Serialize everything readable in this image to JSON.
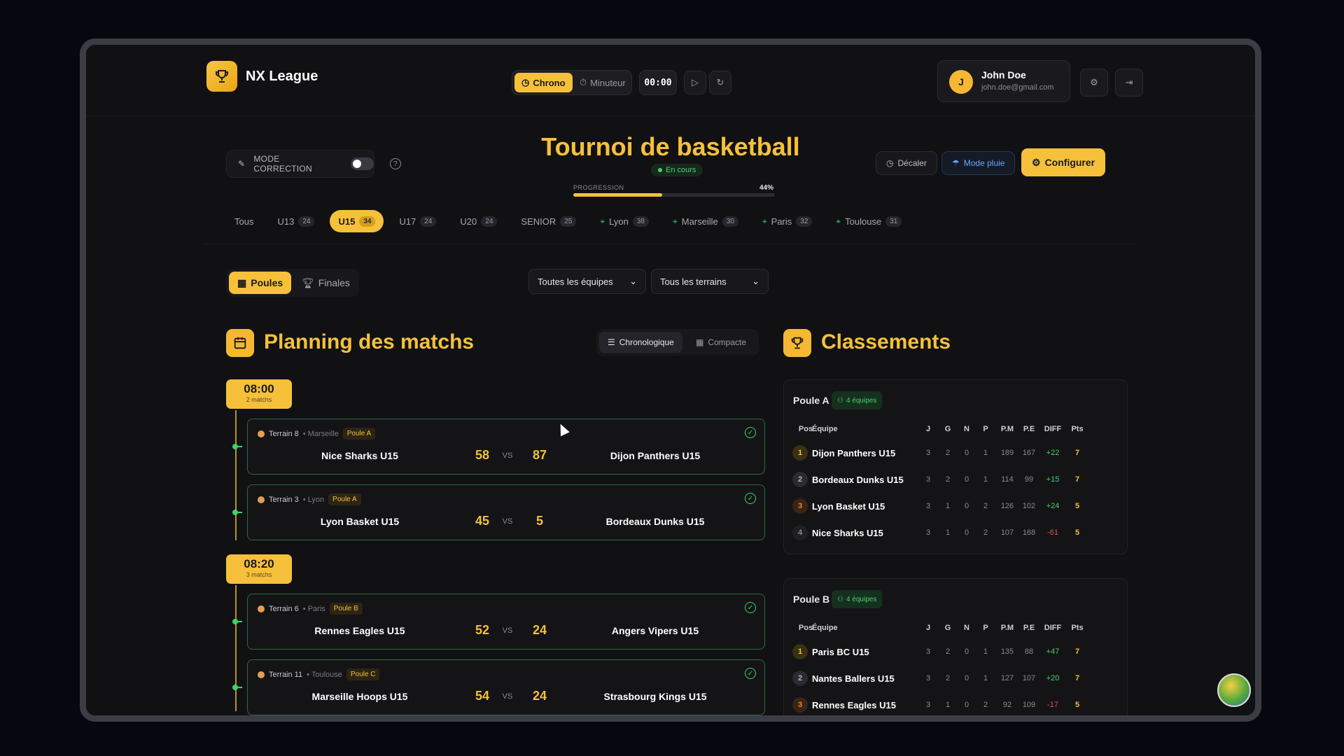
{
  "app": {
    "name": "NX League"
  },
  "timer": {
    "chrono_label": "Chrono",
    "minuteur_label": "Minuteur",
    "time": "00:00"
  },
  "user": {
    "initial": "J",
    "name": "John Doe",
    "email": "john.doe@gmail.com"
  },
  "toolbar": {
    "mode_correction": "MODE CORRECTION",
    "decaler": "Décaler",
    "mode_pluie": "Mode pluie",
    "configurer": "Configurer"
  },
  "tournament": {
    "title": "Tournoi de basketball",
    "status": "En cours",
    "progress_label": "PROGRESSION",
    "progress_text": "44%",
    "progress_value": 0.44
  },
  "categories": [
    {
      "label": "Tous",
      "count": "",
      "active": false,
      "location": false
    },
    {
      "label": "U13",
      "count": "24",
      "active": false,
      "location": false
    },
    {
      "label": "U15",
      "count": "34",
      "active": true,
      "location": false
    },
    {
      "label": "U17",
      "count": "24",
      "active": false,
      "location": false
    },
    {
      "label": "U20",
      "count": "24",
      "active": false,
      "location": false
    },
    {
      "label": "SENIOR",
      "count": "25",
      "active": false,
      "location": false
    },
    {
      "label": "Lyon",
      "count": "38",
      "active": false,
      "location": true
    },
    {
      "label": "Marseille",
      "count": "30",
      "active": false,
      "location": true
    },
    {
      "label": "Paris",
      "count": "32",
      "active": false,
      "location": true
    },
    {
      "label": "Toulouse",
      "count": "31",
      "active": false,
      "location": true
    }
  ],
  "phases": {
    "poules": "Poules",
    "finales": "Finales"
  },
  "filters": {
    "teams": "Toutes les équipes",
    "terrains": "Tous les terrains"
  },
  "planning": {
    "title": "Planning des matchs",
    "view_chrono": "Chronologique",
    "view_compact": "Compacte",
    "vs_label": "VS"
  },
  "slots": [
    {
      "time": "08:00",
      "count_label": "2 matchs",
      "matches": [
        {
          "terrain": "Terrain 8",
          "city": "• Marseille",
          "poule": "Poule A",
          "home": "Nice Sharks U15",
          "home_score": "58",
          "away_score": "87",
          "away": "Dijon Panthers U15"
        },
        {
          "terrain": "Terrain 3",
          "city": "• Lyon",
          "poule": "Poule A",
          "home": "Lyon Basket U15",
          "home_score": "45",
          "away_score": "5",
          "away": "Bordeaux Dunks U15"
        }
      ]
    },
    {
      "time": "08:20",
      "count_label": "3 matchs",
      "matches": [
        {
          "terrain": "Terrain 6",
          "city": "• Paris",
          "poule": "Poule B",
          "home": "Rennes Eagles U15",
          "home_score": "52",
          "away_score": "24",
          "away": "Angers Vipers U15"
        },
        {
          "terrain": "Terrain 11",
          "city": "• Toulouse",
          "poule": "Poule C",
          "home": "Marseille Hoops U15",
          "home_score": "54",
          "away_score": "24",
          "away": "Strasbourg Kings U15"
        }
      ]
    }
  ],
  "standings": {
    "title": "Classements",
    "headers": [
      "Pos",
      "Équipe",
      "J",
      "G",
      "N",
      "P",
      "P.M",
      "P.E",
      "DIFF",
      "Pts"
    ],
    "pools": [
      {
        "name": "Poule A",
        "badge": "4 équipes",
        "rows": [
          [
            "1",
            "Dijon Panthers U15",
            "3",
            "2",
            "0",
            "1",
            "189",
            "167",
            "+22",
            "7"
          ],
          [
            "2",
            "Bordeaux Dunks U15",
            "3",
            "2",
            "0",
            "1",
            "114",
            "99",
            "+15",
            "7"
          ],
          [
            "3",
            "Lyon Basket U15",
            "3",
            "1",
            "0",
            "2",
            "126",
            "102",
            "+24",
            "5"
          ],
          [
            "4",
            "Nice Sharks U15",
            "3",
            "1",
            "0",
            "2",
            "107",
            "168",
            "-61",
            "5"
          ]
        ]
      },
      {
        "name": "Poule B",
        "badge": "4 équipes",
        "rows": [
          [
            "1",
            "Paris BC U15",
            "3",
            "2",
            "0",
            "1",
            "135",
            "88",
            "+47",
            "7"
          ],
          [
            "2",
            "Nantes Ballers U15",
            "3",
            "2",
            "0",
            "1",
            "127",
            "107",
            "+20",
            "7"
          ],
          [
            "3",
            "Rennes Eagles U15",
            "3",
            "1",
            "0",
            "2",
            "92",
            "109",
            "-17",
            "5"
          ]
        ]
      }
    ]
  },
  "colors": {
    "accent": "#f6c03a",
    "success": "#4bd06e",
    "danger": "#e05050",
    "background": "#111113"
  }
}
